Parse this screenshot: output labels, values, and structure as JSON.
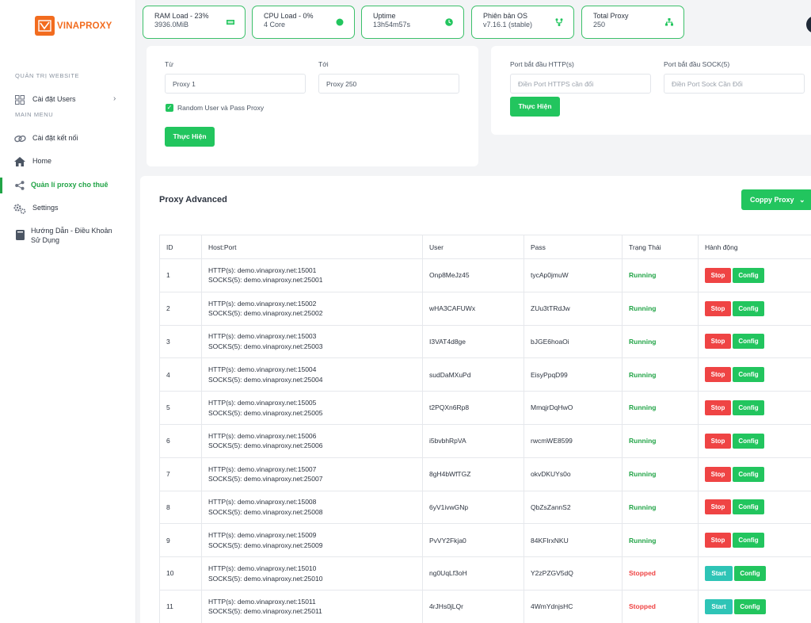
{
  "brand": {
    "name": "VINAPROXY"
  },
  "sidebar": {
    "section_website": "QUẢN TRỊ WEBSITE",
    "section_main": "MAIN MENU",
    "items": [
      {
        "label": "Cài đặt Users",
        "icon": "grid-icon"
      },
      {
        "label": "Cài đặt kết nối",
        "icon": "link-icon"
      },
      {
        "label": "Home",
        "icon": "home-icon"
      },
      {
        "label": "Quản lí proxy cho thuê",
        "icon": "share-icon",
        "active": true
      },
      {
        "label": "Settings",
        "icon": "gears-icon"
      },
      {
        "label": "Hướng Dẫn - Điều Khoản Sử Dụng",
        "icon": "book-icon"
      }
    ]
  },
  "stats": [
    {
      "title": "RAM Load - 23%",
      "value": "3936.0MiB",
      "icon": "ram-icon"
    },
    {
      "title": "CPU Load - 0%",
      "value": "4 Core",
      "icon": "cpu-icon"
    },
    {
      "title": "Uptime",
      "value": "13h54m57s",
      "icon": "clock-icon"
    },
    {
      "title": "Phiên bản OS",
      "value": "v7.16.1 (stable)",
      "icon": "branch-icon"
    },
    {
      "title": "Total Proxy",
      "value": "250",
      "icon": "network-icon"
    }
  ],
  "range_form": {
    "from_label": "Từ",
    "from_value": "Proxy 1",
    "to_label": "Tới",
    "to_value": "Proxy 250",
    "random_label": "Random User và Pass Proxy",
    "submit": "Thực Hiện"
  },
  "port_form": {
    "http_label": "Port bắt đầu HTTP(s)",
    "http_placeholder": "Điền Port HTTPS cần đổi",
    "sock_label": "Port bắt đầu SOCK(5)",
    "sock_placeholder": "Điền Port Sock Cần Đổi",
    "submit": "Thực Hiện"
  },
  "advanced": {
    "title": "Proxy Advanced",
    "copy_button": "Coppy Proxy",
    "columns": [
      "ID",
      "Host:Port",
      "User",
      "Pass",
      "Trạng Thái",
      "Hành động"
    ],
    "rows": [
      {
        "id": "1",
        "http": "HTTP(s): demo.vinaproxy.net:15001",
        "socks": "SOCKS(5): demo.vinaproxy.net:25001",
        "user": "Onp8MeJz45",
        "pass": "tycAp0jmuW",
        "status": "Running",
        "action": "Stop",
        "config": "Config"
      },
      {
        "id": "2",
        "http": "HTTP(s): demo.vinaproxy.net:15002",
        "socks": "SOCKS(5): demo.vinaproxy.net:25002",
        "user": "wHA3CAFUWx",
        "pass": "ZUu3tTRdJw",
        "status": "Running",
        "action": "Stop",
        "config": "Config"
      },
      {
        "id": "3",
        "http": "HTTP(s): demo.vinaproxy.net:15003",
        "socks": "SOCKS(5): demo.vinaproxy.net:25003",
        "user": "I3VAT4d8ge",
        "pass": "bJGE6hoaOi",
        "status": "Running",
        "action": "Stop",
        "config": "Config"
      },
      {
        "id": "4",
        "http": "HTTP(s): demo.vinaproxy.net:15004",
        "socks": "SOCKS(5): demo.vinaproxy.net:25004",
        "user": "sudDaMXuPd",
        "pass": "EisyPpqD99",
        "status": "Running",
        "action": "Stop",
        "config": "Config"
      },
      {
        "id": "5",
        "http": "HTTP(s): demo.vinaproxy.net:15005",
        "socks": "SOCKS(5): demo.vinaproxy.net:25005",
        "user": "t2PQXn6Rp8",
        "pass": "MmqjrDqHwO",
        "status": "Running",
        "action": "Stop",
        "config": "Config"
      },
      {
        "id": "6",
        "http": "HTTP(s): demo.vinaproxy.net:15006",
        "socks": "SOCKS(5): demo.vinaproxy.net:25006",
        "user": "i5bvbhRpVA",
        "pass": "rwcmWE8599",
        "status": "Running",
        "action": "Stop",
        "config": "Config"
      },
      {
        "id": "7",
        "http": "HTTP(s): demo.vinaproxy.net:15007",
        "socks": "SOCKS(5): demo.vinaproxy.net:25007",
        "user": "8gH4bWfTGZ",
        "pass": "okvDKUYs0o",
        "status": "Running",
        "action": "Stop",
        "config": "Config"
      },
      {
        "id": "8",
        "http": "HTTP(s): demo.vinaproxy.net:15008",
        "socks": "SOCKS(5): demo.vinaproxy.net:25008",
        "user": "6yV1ivwGNp",
        "pass": "QbZsZannS2",
        "status": "Running",
        "action": "Stop",
        "config": "Config"
      },
      {
        "id": "9",
        "http": "HTTP(s): demo.vinaproxy.net:15009",
        "socks": "SOCKS(5): demo.vinaproxy.net:25009",
        "user": "PvVY2Fkja0",
        "pass": "84KFIrxNKU",
        "status": "Running",
        "action": "Stop",
        "config": "Config"
      },
      {
        "id": "10",
        "http": "HTTP(s): demo.vinaproxy.net:15010",
        "socks": "SOCKS(5): demo.vinaproxy.net:25010",
        "user": "ng0UqLf3oH",
        "pass": "Y2zPZGV5dQ",
        "status": "Stopped",
        "action": "Start",
        "config": "Config"
      },
      {
        "id": "11",
        "http": "HTTP(s): demo.vinaproxy.net:15011",
        "socks": "SOCKS(5): demo.vinaproxy.net:25011",
        "user": "4rJHs0jLQr",
        "pass": "4WmYdnjsHC",
        "status": "Stopped",
        "action": "Start",
        "config": "Config"
      }
    ]
  },
  "colors": {
    "accent": "#22c55e",
    "brand": "#f26c1f",
    "danger": "#ef4444",
    "start": "#2ec4b6"
  }
}
